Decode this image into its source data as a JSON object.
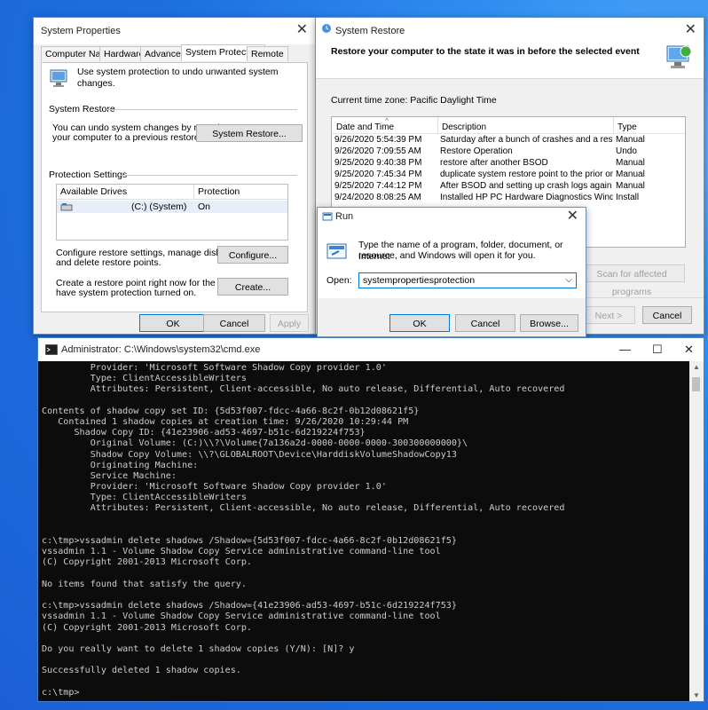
{
  "sysprops": {
    "title": "System Properties",
    "tabs": [
      "Computer Name",
      "Hardware",
      "Advanced",
      "System Protection",
      "Remote"
    ],
    "intro": "Use system protection to undo unwanted system changes.",
    "restore_group": "System Restore",
    "restore_desc_1": "You can undo system changes by reverting",
    "restore_desc_2": "your computer to a previous restore point.",
    "restore_btn": "System Restore...",
    "protection_group": "Protection Settings",
    "col_drives": "Available Drives",
    "col_protection": "Protection",
    "drive_name": "(C:) (System)",
    "drive_status": "On",
    "configure_desc_1": "Configure restore settings, manage disk space,",
    "configure_desc_2": "and delete restore points.",
    "configure_btn": "Configure...",
    "create_desc_1": "Create a restore point right now for the drives that",
    "create_desc_2": "have system protection turned on.",
    "create_btn": "Create...",
    "ok": "OK",
    "cancel": "Cancel",
    "apply": "Apply"
  },
  "restore": {
    "title": "System Restore",
    "heading": "Restore your computer to the state it was in before the selected event",
    "timezone": "Current time zone: Pacific Daylight Time",
    "columns": [
      "Date and Time",
      "Description",
      "Type"
    ],
    "rows": [
      [
        "9/26/2020 5:54:39 PM",
        "Saturday after a bunch of crashes and a restore",
        "Manual"
      ],
      [
        "9/26/2020 7:09:55 AM",
        "Restore Operation",
        "Undo"
      ],
      [
        "9/25/2020 9:40:38 PM",
        "restore after another BSOD",
        "Manual"
      ],
      [
        "9/25/2020 7:45:34 PM",
        "duplicate system restore point to the prior one",
        "Manual"
      ],
      [
        "9/25/2020 7:44:12 PM",
        "After BSOD and setting up crash logs again",
        "Manual"
      ],
      [
        "9/24/2020 8:08:25 AM",
        "Installed HP PC Hardware Diagnostics Windows",
        "Install"
      ]
    ],
    "scan_btn": "Scan for affected programs",
    "next_btn": "Next >",
    "cancel_btn": "Cancel"
  },
  "run": {
    "title": "Run",
    "desc_1": "Type the name of a program, folder, document, or Internet",
    "desc_2": "resource, and Windows will open it for you.",
    "open_label": "Open:",
    "open_value": "systempropertiesprotection",
    "ok": "OK",
    "cancel": "Cancel",
    "browse": "Browse..."
  },
  "cmd": {
    "title": "Administrator: C:\\Windows\\system32\\cmd.exe",
    "lines": [
      "         Provider: 'Microsoft Software Shadow Copy provider 1.0'",
      "         Type: ClientAccessibleWriters",
      "         Attributes: Persistent, Client-accessible, No auto release, Differential, Auto recovered",
      "",
      "Contents of shadow copy set ID: {5d53f007-fdcc-4a66-8c2f-0b12d08621f5}",
      "   Contained 1 shadow copies at creation time: 9/26/2020 10:29:44 PM",
      "      Shadow Copy ID: {41e23906-ad53-4697-b51c-6d219224f753}",
      "         Original Volume: (C:)\\\\?\\Volume{7a136a2d-0000-0000-0000-300300000000}\\",
      "         Shadow Copy Volume: \\\\?\\GLOBALROOT\\Device\\HarddiskVolumeShadowCopy13",
      "         Originating Machine:",
      "         Service Machine:",
      "         Provider: 'Microsoft Software Shadow Copy provider 1.0'",
      "         Type: ClientAccessibleWriters",
      "         Attributes: Persistent, Client-accessible, No auto release, Differential, Auto recovered",
      "",
      "",
      "c:\\tmp>vssadmin delete shadows /Shadow={5d53f007-fdcc-4a66-8c2f-0b12d08621f5}",
      "vssadmin 1.1 - Volume Shadow Copy Service administrative command-line tool",
      "(C) Copyright 2001-2013 Microsoft Corp.",
      "",
      "No items found that satisfy the query.",
      "",
      "c:\\tmp>vssadmin delete shadows /Shadow={41e23906-ad53-4697-b51c-6d219224f753}",
      "vssadmin 1.1 - Volume Shadow Copy Service administrative command-line tool",
      "(C) Copyright 2001-2013 Microsoft Corp.",
      "",
      "Do you really want to delete 1 shadow copies (Y/N): [N]? y",
      "",
      "Successfully deleted 1 shadow copies.",
      "",
      "c:\\tmp>"
    ]
  }
}
